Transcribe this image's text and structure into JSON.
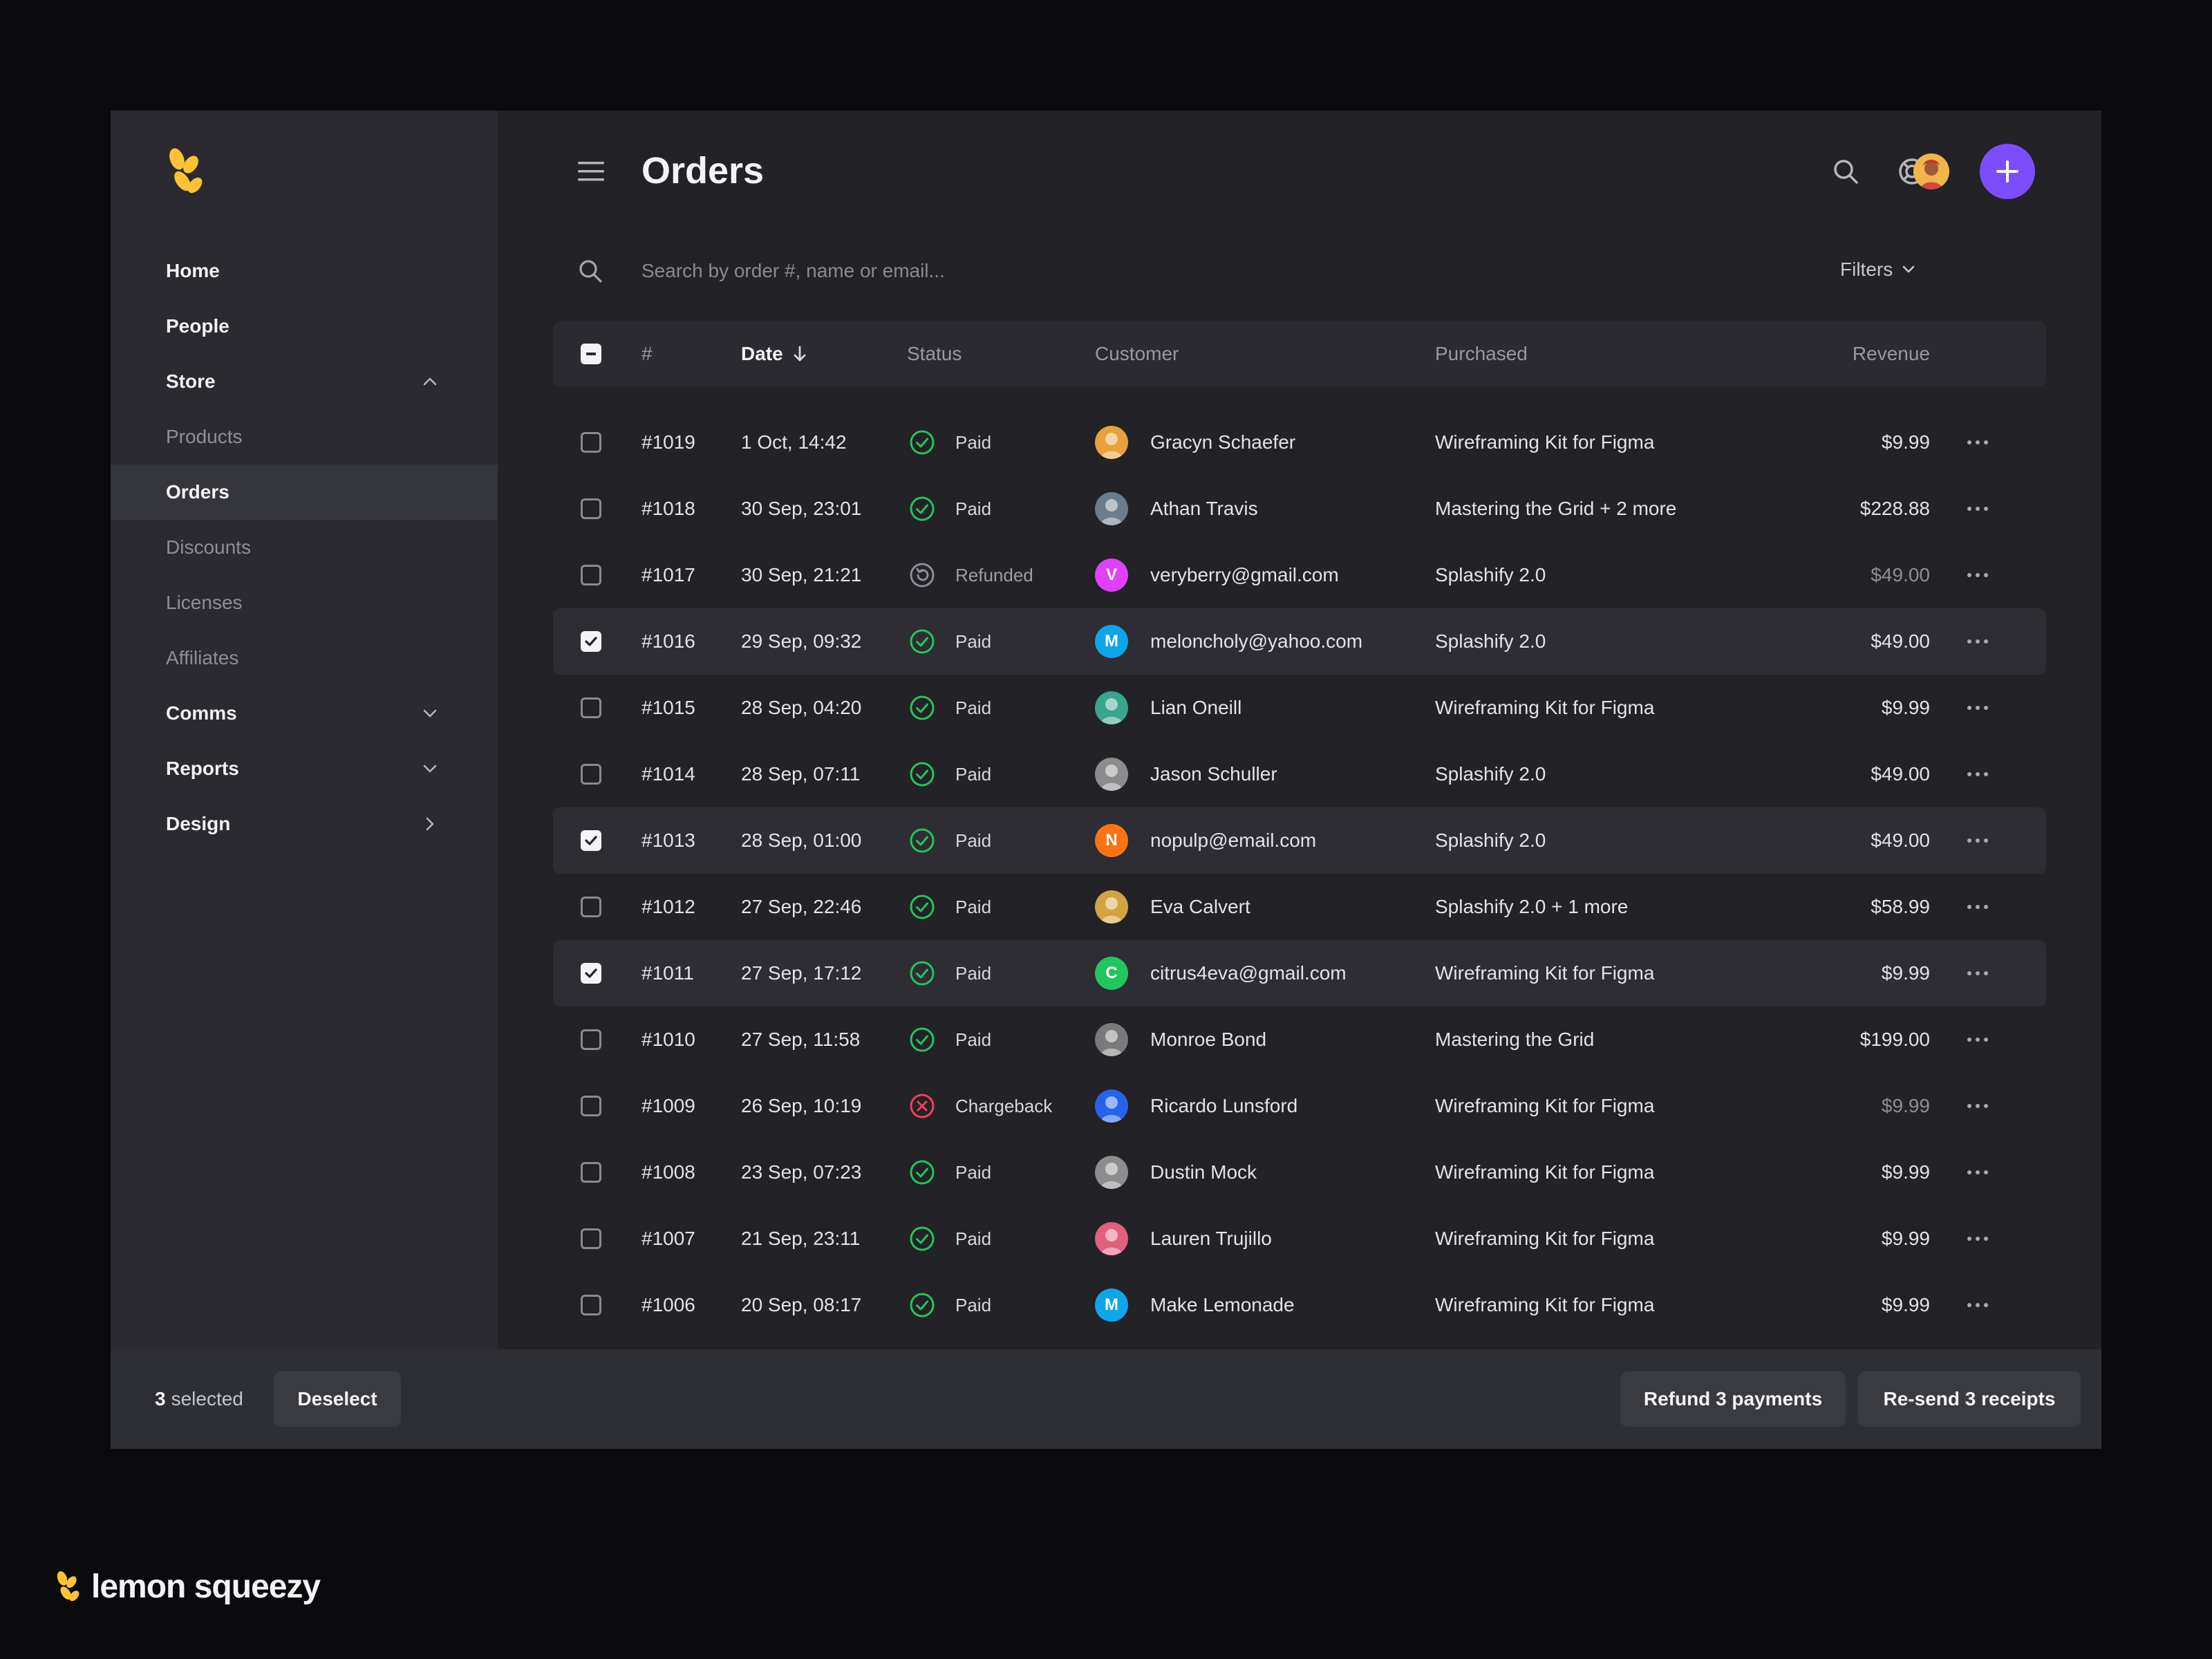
{
  "colors": {
    "accent": "#7c4dff",
    "paid": "#22c55e",
    "chargeback": "#f43f5e",
    "logo": "#ffc233"
  },
  "page": {
    "title": "Orders"
  },
  "sidebar": {
    "items": [
      {
        "label": "Home",
        "type": "top"
      },
      {
        "label": "People",
        "type": "top"
      },
      {
        "label": "Store",
        "type": "top",
        "chevron": "chevron-up-icon"
      },
      {
        "label": "Products",
        "type": "sub"
      },
      {
        "label": "Orders",
        "type": "sub",
        "active": true
      },
      {
        "label": "Discounts",
        "type": "sub"
      },
      {
        "label": "Licenses",
        "type": "sub"
      },
      {
        "label": "Affiliates",
        "type": "sub"
      },
      {
        "label": "Comms",
        "type": "top",
        "chevron": "chevron-down-icon"
      },
      {
        "label": "Reports",
        "type": "top",
        "chevron": "chevron-down-icon"
      },
      {
        "label": "Design",
        "type": "top",
        "chevron": "chevron-right-icon"
      }
    ]
  },
  "search": {
    "placeholder": "Search by order #, name or email...",
    "value": ""
  },
  "filters_label": "Filters",
  "table": {
    "headers": {
      "number": "#",
      "date": "Date",
      "status": "Status",
      "customer": "Customer",
      "purchased": "Purchased",
      "revenue": "Revenue"
    },
    "rows": [
      {
        "selected": false,
        "number": "#1019",
        "date": "1 Oct, 14:42",
        "status": "Paid",
        "customer": "Gracyn Schaefer",
        "avatar": {
          "kind": "photo",
          "color": "#e9a13b"
        },
        "purchased": "Wireframing Kit for Figma",
        "revenue": "$9.99",
        "muted": false
      },
      {
        "selected": false,
        "number": "#1018",
        "date": "30 Sep, 23:01",
        "status": "Paid",
        "customer": "Athan Travis",
        "avatar": {
          "kind": "photo",
          "color": "#6d7c8a"
        },
        "purchased": "Mastering the Grid + 2 more",
        "revenue": "$228.88",
        "muted": false
      },
      {
        "selected": false,
        "number": "#1017",
        "date": "30 Sep, 21:21",
        "status": "Refunded",
        "customer": "veryberry@gmail.com",
        "avatar": {
          "kind": "letter",
          "letter": "V",
          "color": "#e040fb"
        },
        "purchased": "Splashify 2.0",
        "revenue": "$49.00",
        "muted": true
      },
      {
        "selected": true,
        "number": "#1016",
        "date": "29 Sep, 09:32",
        "status": "Paid",
        "customer": "meloncholy@yahoo.com",
        "avatar": {
          "kind": "letter",
          "letter": "M",
          "color": "#0ea5e9"
        },
        "purchased": "Splashify 2.0",
        "revenue": "$49.00",
        "muted": false
      },
      {
        "selected": false,
        "number": "#1015",
        "date": "28 Sep, 04:20",
        "status": "Paid",
        "customer": "Lian Oneill",
        "avatar": {
          "kind": "photo",
          "color": "#3aa48c"
        },
        "purchased": "Wireframing Kit for Figma",
        "revenue": "$9.99",
        "muted": false
      },
      {
        "selected": false,
        "number": "#1014",
        "date": "28 Sep, 07:11",
        "status": "Paid",
        "customer": "Jason Schuller",
        "avatar": {
          "kind": "photo",
          "color": "#8c8c8c"
        },
        "purchased": "Splashify 2.0",
        "revenue": "$49.00",
        "muted": false
      },
      {
        "selected": true,
        "number": "#1013",
        "date": "28 Sep, 01:00",
        "status": "Paid",
        "customer": "nopulp@email.com",
        "avatar": {
          "kind": "letter",
          "letter": "N",
          "color": "#f97316"
        },
        "purchased": "Splashify 2.0",
        "revenue": "$49.00",
        "muted": false
      },
      {
        "selected": false,
        "number": "#1012",
        "date": "27 Sep, 22:46",
        "status": "Paid",
        "customer": "Eva Calvert",
        "avatar": {
          "kind": "photo",
          "color": "#d4a341"
        },
        "purchased": "Splashify 2.0 + 1 more",
        "revenue": "$58.99",
        "muted": false
      },
      {
        "selected": true,
        "number": "#1011",
        "date": "27 Sep, 17:12",
        "status": "Paid",
        "customer": "citrus4eva@gmail.com",
        "avatar": {
          "kind": "letter",
          "letter": "C",
          "color": "#22c55e"
        },
        "purchased": "Wireframing Kit for Figma",
        "revenue": "$9.99",
        "muted": false
      },
      {
        "selected": false,
        "number": "#1010",
        "date": "27 Sep, 11:58",
        "status": "Paid",
        "customer": "Monroe Bond",
        "avatar": {
          "kind": "photo",
          "color": "#7a7a7a"
        },
        "purchased": "Mastering the Grid",
        "revenue": "$199.00",
        "muted": false
      },
      {
        "selected": false,
        "number": "#1009",
        "date": "26 Sep, 10:19",
        "status": "Chargeback",
        "customer": "Ricardo Lunsford",
        "avatar": {
          "kind": "photo",
          "color": "#2563eb"
        },
        "purchased": "Wireframing Kit for Figma",
        "revenue": "$9.99",
        "muted": true
      },
      {
        "selected": false,
        "number": "#1008",
        "date": "23 Sep, 07:23",
        "status": "Paid",
        "customer": "Dustin Mock",
        "avatar": {
          "kind": "photo",
          "color": "#8d8d8d"
        },
        "purchased": "Wireframing Kit for Figma",
        "revenue": "$9.99",
        "muted": false
      },
      {
        "selected": false,
        "number": "#1007",
        "date": "21 Sep, 23:11",
        "status": "Paid",
        "customer": "Lauren Trujillo",
        "avatar": {
          "kind": "photo",
          "color": "#e0607e"
        },
        "purchased": "Wireframing Kit for Figma",
        "revenue": "$9.99",
        "muted": false
      },
      {
        "selected": false,
        "number": "#1006",
        "date": "20 Sep, 08:17",
        "status": "Paid",
        "customer": "Make Lemonade",
        "avatar": {
          "kind": "letter",
          "letter": "M",
          "color": "#0ea5e9"
        },
        "purchased": "Wireframing Kit for Figma",
        "revenue": "$9.99",
        "muted": false
      }
    ]
  },
  "bottom": {
    "selected_count": "3",
    "selected_label": "selected",
    "deselect": "Deselect",
    "refund": "Refund 3 payments",
    "resend": "Re-send 3 receipts"
  },
  "brand": {
    "name": "lemon squeezy"
  }
}
